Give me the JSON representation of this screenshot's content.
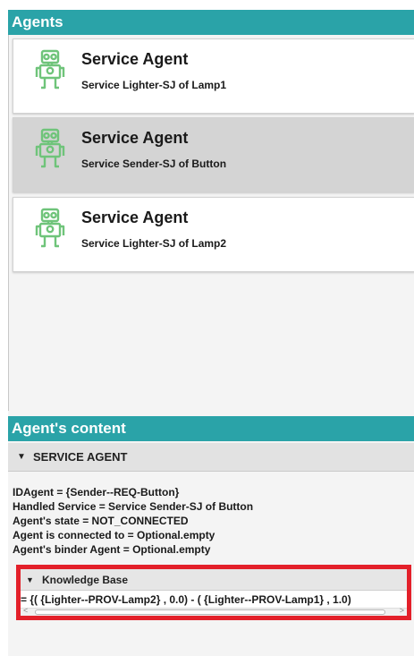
{
  "agents_panel": {
    "title": "Agents",
    "agents": [
      {
        "name": "Service Agent",
        "subtitle": "Service Lighter-SJ of Lamp1",
        "icon": "robot-icon",
        "selected": false
      },
      {
        "name": "Service Agent",
        "subtitle": "Service Sender-SJ of Button",
        "icon": "robot-icon",
        "selected": true
      },
      {
        "name": "Service Agent",
        "subtitle": "Service Lighter-SJ of Lamp2",
        "icon": "robot-icon",
        "selected": false
      }
    ]
  },
  "content_panel": {
    "title": "Agent's content",
    "section_title": "SERVICE AGENT",
    "lines": [
      "IDAgent = {Sender--REQ-Button}",
      "Handled Service  = Service Sender-SJ of Button",
      "Agent's state  = NOT_CONNECTED",
      "Agent is connected to  = Optional.empty",
      "Agent's binder Agent  = Optional.empty"
    ],
    "knowledge_base": {
      "title": "Knowledge Base",
      "text": "= {( {Lighter--PROV-Lamp2} , 0.0) - ( {Lighter--PROV-Lamp1} , 1.0)"
    }
  },
  "colors": {
    "header": "#2aa3a8",
    "robot": "#6fc47a",
    "highlight": "#e3202a",
    "selected": "#d4d4d4"
  }
}
